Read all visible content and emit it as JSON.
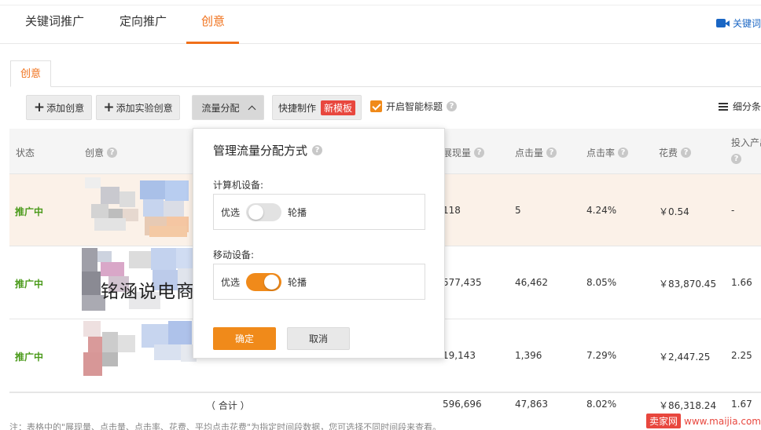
{
  "nav": {
    "tabs": [
      "关键词推广",
      "定向推广",
      "创意"
    ],
    "active_index": 2,
    "video_link": "关键词"
  },
  "panel": {
    "tab": "创意"
  },
  "toolbar": {
    "add_creative": "添加创意",
    "add_experiment": "添加实验创意",
    "traffic": "流量分配",
    "quick_make": "快捷制作",
    "new_template": "新模板",
    "smart_title": "开启智能标题",
    "segment": "细分条"
  },
  "table": {
    "headers": {
      "status": "状态",
      "creative": "创意",
      "impressions": "展现量",
      "clicks": "点击量",
      "ctr": "点击率",
      "cost": "花费",
      "roi": "投入产出"
    },
    "rows": [
      {
        "status": "推广中",
        "impressions": "118",
        "clicks": "5",
        "ctr": "4.24%",
        "cost": "￥0.54",
        "roi": "-"
      },
      {
        "status": "推广中",
        "impressions": "577,435",
        "clicks": "46,462",
        "ctr": "8.05%",
        "cost": "￥83,870.45",
        "roi": "1.66"
      },
      {
        "status": "推广中",
        "impressions": "19,143",
        "clicks": "1,396",
        "ctr": "7.29%",
        "cost": "￥2,447.25",
        "roi": "2.25"
      }
    ],
    "total": {
      "label": "（ 合计 ）",
      "impressions": "596,696",
      "clicks": "47,863",
      "ctr": "8.02%",
      "cost": "￥86,318.24",
      "roi": "1.67"
    }
  },
  "popup": {
    "title": "管理流量分配方式",
    "pc_label": "计算机设备:",
    "mobile_label": "移动设备:",
    "opt_prefer": "优选",
    "opt_rotate": "轮播",
    "pc_on": false,
    "mobile_on": true,
    "ok": "确定",
    "cancel": "取消"
  },
  "note": "注：表格中的\"展现量、点击量、点击率、花费、平均点击花费\"为指定时间段数据，您可选择不同时间段来查看。",
  "watermark": "铭涵说电商",
  "site_watermark": {
    "brand": "卖家网",
    "url": "www.maijia.com"
  },
  "colors": {
    "accent": "#f0701a",
    "status_green": "#4a9a1a",
    "link_blue": "#1a66c4",
    "toggle_on": "#f08a1a"
  }
}
